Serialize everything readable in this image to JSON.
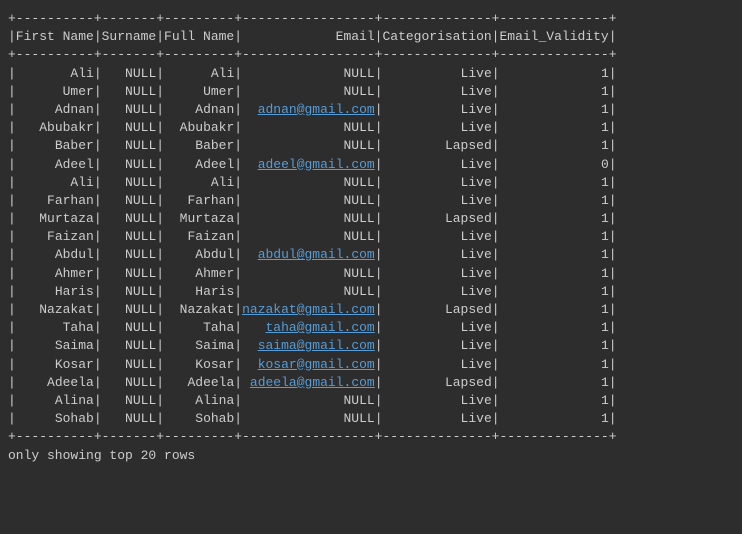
{
  "columns": [
    "First Name",
    "Surname",
    "Full Name",
    "Email",
    "Categorisation",
    "Email_Validity"
  ],
  "widths": [
    10,
    7,
    9,
    17,
    14,
    14
  ],
  "rows": [
    {
      "first": "Ali",
      "surname": "NULL",
      "full": "Ali",
      "email": "NULL",
      "cat": "Live",
      "valid": "1"
    },
    {
      "first": "Umer",
      "surname": "NULL",
      "full": "Umer",
      "email": "NULL",
      "cat": "Live",
      "valid": "1"
    },
    {
      "first": "Adnan",
      "surname": "NULL",
      "full": "Adnan",
      "email": "adnan@gmail.com",
      "cat": "Live",
      "valid": "1"
    },
    {
      "first": "Abubakr",
      "surname": "NULL",
      "full": "Abubakr",
      "email": "NULL",
      "cat": "Live",
      "valid": "1"
    },
    {
      "first": "Baber",
      "surname": "NULL",
      "full": "Baber",
      "email": "NULL",
      "cat": "Lapsed",
      "valid": "1"
    },
    {
      "first": "Adeel",
      "surname": "NULL",
      "full": "Adeel",
      "email": "adeel@gmail.com",
      "cat": "Live",
      "valid": "0"
    },
    {
      "first": "Ali",
      "surname": "NULL",
      "full": "Ali",
      "email": "NULL",
      "cat": "Live",
      "valid": "1"
    },
    {
      "first": "Farhan",
      "surname": "NULL",
      "full": "Farhan",
      "email": "NULL",
      "cat": "Live",
      "valid": "1"
    },
    {
      "first": "Murtaza",
      "surname": "NULL",
      "full": "Murtaza",
      "email": "NULL",
      "cat": "Lapsed",
      "valid": "1"
    },
    {
      "first": "Faizan",
      "surname": "NULL",
      "full": "Faizan",
      "email": "NULL",
      "cat": "Live",
      "valid": "1"
    },
    {
      "first": "Abdul",
      "surname": "NULL",
      "full": "Abdul",
      "email": "abdul@gmail.com",
      "cat": "Live",
      "valid": "1"
    },
    {
      "first": "Ahmer",
      "surname": "NULL",
      "full": "Ahmer",
      "email": "NULL",
      "cat": "Live",
      "valid": "1"
    },
    {
      "first": "Haris",
      "surname": "NULL",
      "full": "Haris",
      "email": "NULL",
      "cat": "Live",
      "valid": "1"
    },
    {
      "first": "Nazakat",
      "surname": "NULL",
      "full": "Nazakat",
      "email": "nazakat@gmail.com",
      "cat": "Lapsed",
      "valid": "1"
    },
    {
      "first": "Taha",
      "surname": "NULL",
      "full": "Taha",
      "email": "taha@gmail.com",
      "cat": "Live",
      "valid": "1"
    },
    {
      "first": "Saima",
      "surname": "NULL",
      "full": "Saima",
      "email": "saima@gmail.com",
      "cat": "Live",
      "valid": "1"
    },
    {
      "first": "Kosar",
      "surname": "NULL",
      "full": "Kosar",
      "email": "kosar@gmail.com",
      "cat": "Live",
      "valid": "1"
    },
    {
      "first": "Adeela",
      "surname": "NULL",
      "full": "Adeela",
      "email": "adeela@gmail.com",
      "cat": "Lapsed",
      "valid": "1"
    },
    {
      "first": "Alina",
      "surname": "NULL",
      "full": "Alina",
      "email": "NULL",
      "cat": "Live",
      "valid": "1"
    },
    {
      "first": "Sohab",
      "surname": "NULL",
      "full": "Sohab",
      "email": "NULL",
      "cat": "Live",
      "valid": "1"
    }
  ],
  "footer": "only showing top 20 rows"
}
